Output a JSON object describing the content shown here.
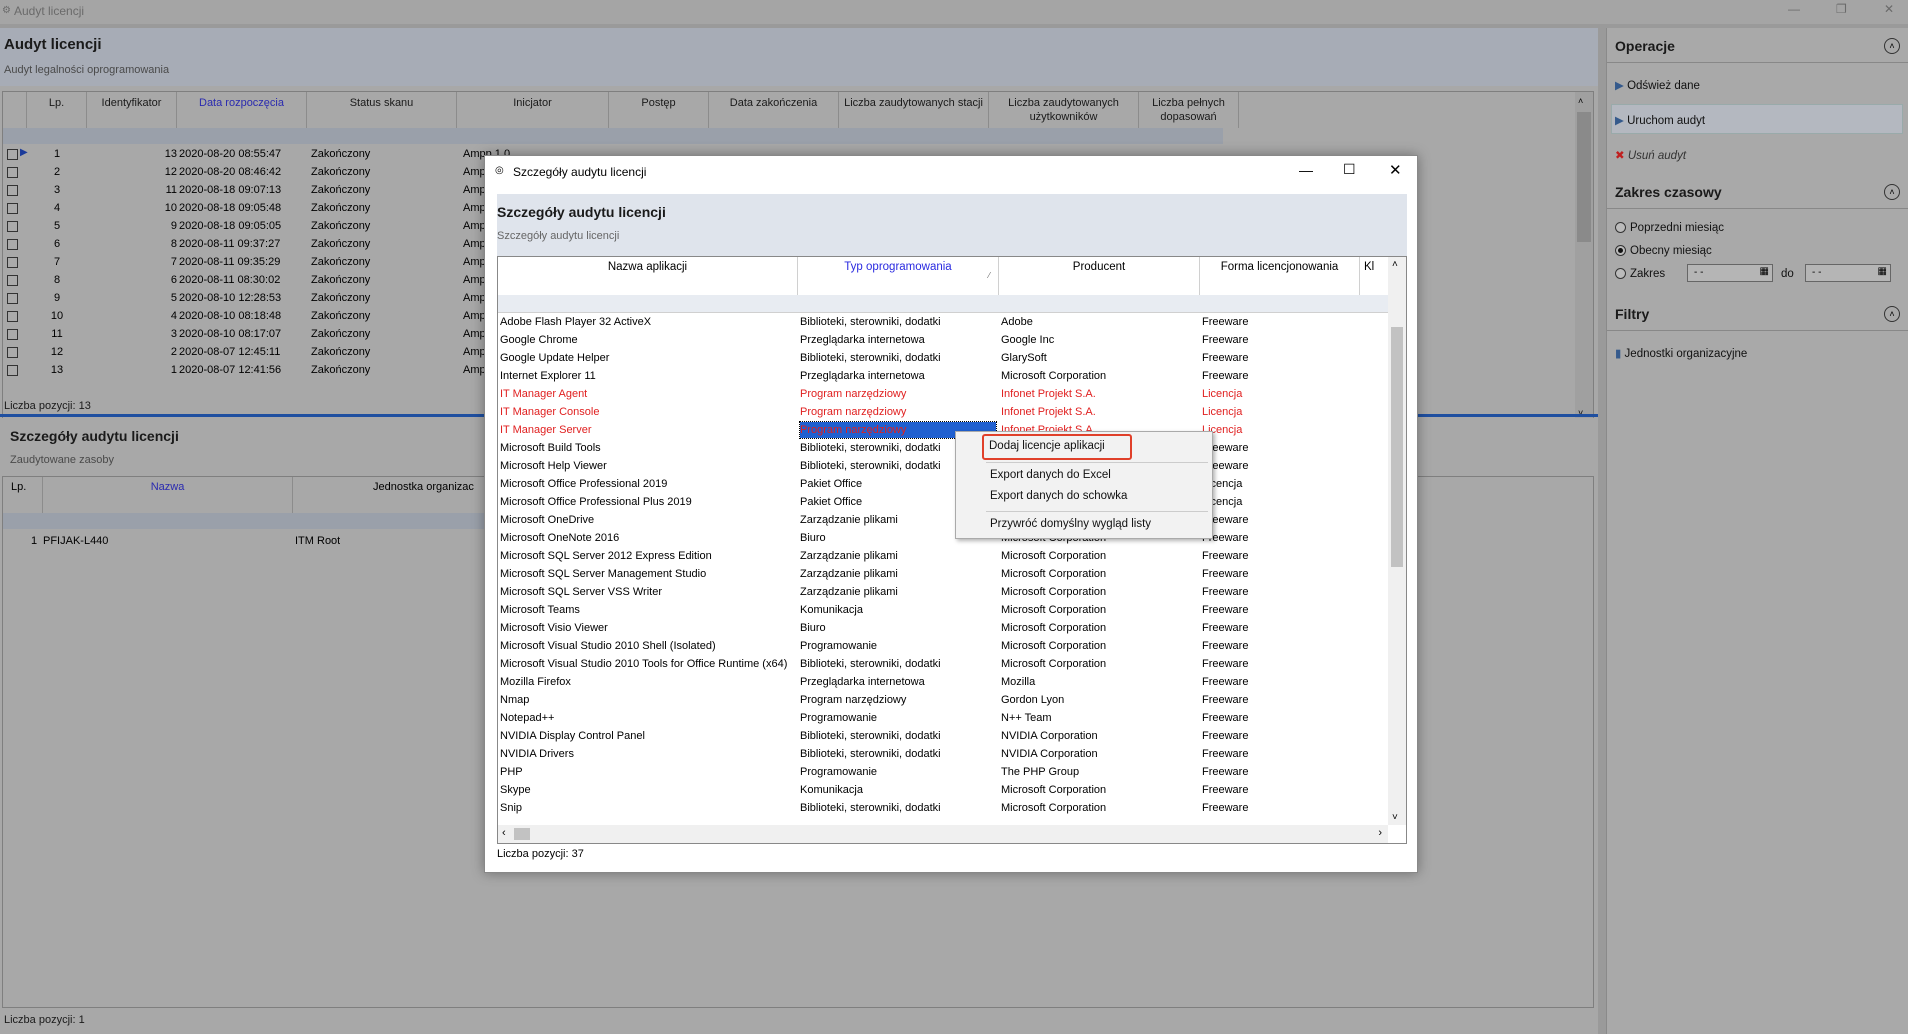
{
  "window": {
    "title": "Audyt licencji"
  },
  "top_panel": {
    "title": "Audyt licencji",
    "subtitle": "Audyt legalności oprogramowania",
    "columns": [
      "Lp.",
      "Identyfikator",
      "Data rozpoczęcia",
      "Status skanu",
      "Inicjator",
      "Postęp",
      "Data zakończenia",
      "Liczba zaudytowanych stacji",
      "Liczba zaudytowanych użytkowników",
      "Liczba pełnych dopasowań"
    ],
    "rows": [
      {
        "lp": "1",
        "id": "13",
        "date": "2020-08-20 08:55:47",
        "status": "Zakończony",
        "init": "Ampp 1.0..."
      },
      {
        "lp": "2",
        "id": "12",
        "date": "2020-08-20 08:46:42",
        "status": "Zakończony",
        "init": "Ampp 1.0"
      },
      {
        "lp": "3",
        "id": "11",
        "date": "2020-08-18 09:07:13",
        "status": "Zakończony",
        "init": "Ampp 1.0"
      },
      {
        "lp": "4",
        "id": "10",
        "date": "2020-08-18 09:05:48",
        "status": "Zakończony",
        "init": "Ampp 1.0"
      },
      {
        "lp": "5",
        "id": "9",
        "date": "2020-08-18 09:05:05",
        "status": "Zakończony",
        "init": "Ampp 1.0"
      },
      {
        "lp": "6",
        "id": "8",
        "date": "2020-08-11 09:37:27",
        "status": "Zakończony",
        "init": "Ampp 1.0"
      },
      {
        "lp": "7",
        "id": "7",
        "date": "2020-08-11 09:35:29",
        "status": "Zakończony",
        "init": "Ampp 1.0"
      },
      {
        "lp": "8",
        "id": "6",
        "date": "2020-08-11 08:30:02",
        "status": "Zakończony",
        "init": "Ampp 1.0"
      },
      {
        "lp": "9",
        "id": "5",
        "date": "2020-08-10 12:28:53",
        "status": "Zakończony",
        "init": "Ampp 1.0"
      },
      {
        "lp": "10",
        "id": "4",
        "date": "2020-08-10 08:18:48",
        "status": "Zakończony",
        "init": "Ampp 1.0"
      },
      {
        "lp": "11",
        "id": "3",
        "date": "2020-08-10 08:17:07",
        "status": "Zakończony",
        "init": "Ampp 1.0"
      },
      {
        "lp": "12",
        "id": "2",
        "date": "2020-08-07 12:45:11",
        "status": "Zakończony",
        "init": "Ampp 1.0"
      },
      {
        "lp": "13",
        "id": "1",
        "date": "2020-08-07 12:41:56",
        "status": "Zakończony",
        "init": "Ampp 1.0"
      }
    ],
    "count_label": "Liczba pozycji: 13"
  },
  "bottom_panel": {
    "title": "Szczegóły audytu licencji",
    "subtitle": "Zaudytowane zasoby",
    "columns": [
      "Lp.",
      "Nazwa",
      "Jednostka organizac"
    ],
    "rows": [
      {
        "lp": "1",
        "name": "PFIJAK-L440",
        "unit": "ITM Root"
      }
    ],
    "count_label": "Liczba pozycji: 1"
  },
  "right_panel": {
    "operacje": "Operacje",
    "refresh": "Odśwież dane",
    "run": "Uruchom audyt",
    "delete": "Usuń audyt",
    "zakres": "Zakres czasowy",
    "prev_month": "Poprzedni miesiąc",
    "this_month": "Obecny miesiąc",
    "range": "Zakres",
    "date_placeholder": "- -",
    "to": "do",
    "filtry": "Filtry",
    "org_units": "Jednostki organizacyjne"
  },
  "dialog": {
    "title": "Szczegóły audytu licencji",
    "header": "Szczegóły audytu licencji",
    "subheader": "Szczegóły audytu licencji",
    "columns": [
      "Nazwa aplikacji",
      "Typ oprogramowania",
      "Producent",
      "Forma licencjonowania",
      "Kl"
    ],
    "rows": [
      {
        "name": "Adobe Flash Player 32 ActiveX",
        "type": "Biblioteki, sterowniki, dodatki",
        "vendor": "Adobe",
        "lic": "Freeware",
        "red": false
      },
      {
        "name": "Google Chrome",
        "type": "Przeglądarka internetowa",
        "vendor": "Google Inc",
        "lic": "Freeware",
        "red": false
      },
      {
        "name": "Google Update Helper",
        "type": "Biblioteki, sterowniki, dodatki",
        "vendor": "GlarySoft",
        "lic": "Freeware",
        "red": false
      },
      {
        "name": "Internet Explorer 11",
        "type": "Przeglądarka internetowa",
        "vendor": "Microsoft Corporation",
        "lic": "Freeware",
        "red": false
      },
      {
        "name": "IT Manager Agent",
        "type": "Program narzędziowy",
        "vendor": "Infonet Projekt S.A.",
        "lic": "Licencja",
        "red": true
      },
      {
        "name": "IT Manager Console",
        "type": "Program narzędziowy",
        "vendor": "Infonet Projekt S.A.",
        "lic": "Licencja",
        "red": true
      },
      {
        "name": "IT Manager Server",
        "type": "Program narzędziowy",
        "vendor": "Infonet Projekt S.A.",
        "lic": "Licencja",
        "red": true
      },
      {
        "name": "Microsoft Build Tools",
        "type": "Biblioteki, sterowniki, dodatki",
        "vendor": "",
        "lic": "Freeware",
        "red": false
      },
      {
        "name": "Microsoft Help Viewer",
        "type": "Biblioteki, sterowniki, dodatki",
        "vendor": "",
        "lic": "Freeware",
        "red": false
      },
      {
        "name": "Microsoft Office Professional 2019",
        "type": "Pakiet Office",
        "vendor": "",
        "lic": "Licencja",
        "red": false
      },
      {
        "name": "Microsoft Office Professional Plus 2019",
        "type": "Pakiet Office",
        "vendor": "",
        "lic": "Licencja",
        "red": false
      },
      {
        "name": "Microsoft OneDrive",
        "type": "Zarządzanie plikami",
        "vendor": "",
        "lic": "Freeware",
        "red": false
      },
      {
        "name": "Microsoft OneNote 2016",
        "type": "Biuro",
        "vendor": "Microsoft Corporation",
        "lic": "Freeware",
        "red": false
      },
      {
        "name": "Microsoft SQL Server 2012 Express Edition",
        "type": "Zarządzanie plikami",
        "vendor": "Microsoft Corporation",
        "lic": "Freeware",
        "red": false
      },
      {
        "name": "Microsoft SQL Server Management Studio",
        "type": "Zarządzanie plikami",
        "vendor": "Microsoft Corporation",
        "lic": "Freeware",
        "red": false
      },
      {
        "name": "Microsoft SQL Server VSS Writer",
        "type": "Zarządzanie plikami",
        "vendor": "Microsoft Corporation",
        "lic": "Freeware",
        "red": false
      },
      {
        "name": "Microsoft Teams",
        "type": "Komunikacja",
        "vendor": "Microsoft Corporation",
        "lic": "Freeware",
        "red": false
      },
      {
        "name": "Microsoft Visio Viewer",
        "type": "Biuro",
        "vendor": "Microsoft Corporation",
        "lic": "Freeware",
        "red": false
      },
      {
        "name": "Microsoft Visual Studio 2010 Shell (Isolated)",
        "type": "Programowanie",
        "vendor": "Microsoft Corporation",
        "lic": "Freeware",
        "red": false
      },
      {
        "name": "Microsoft Visual Studio 2010 Tools for Office Runtime (x64)",
        "type": "Biblioteki, sterowniki, dodatki",
        "vendor": "Microsoft Corporation",
        "lic": "Freeware",
        "red": false
      },
      {
        "name": "Mozilla Firefox",
        "type": "Przeglądarka internetowa",
        "vendor": "Mozilla",
        "lic": "Freeware",
        "red": false
      },
      {
        "name": "Nmap",
        "type": "Program narzędziowy",
        "vendor": "Gordon Lyon",
        "lic": "Freeware",
        "red": false
      },
      {
        "name": "Notepad++",
        "type": "Programowanie",
        "vendor": "N++ Team",
        "lic": "Freeware",
        "red": false
      },
      {
        "name": "NVIDIA Display Control Panel",
        "type": "Biblioteki, sterowniki, dodatki",
        "vendor": "NVIDIA Corporation",
        "lic": "Freeware",
        "red": false
      },
      {
        "name": "NVIDIA Drivers",
        "type": "Biblioteki, sterowniki, dodatki",
        "vendor": "NVIDIA Corporation",
        "lic": "Freeware",
        "red": false
      },
      {
        "name": "PHP",
        "type": "Programowanie",
        "vendor": "The PHP Group",
        "lic": "Freeware",
        "red": false
      },
      {
        "name": "Skype",
        "type": "Komunikacja",
        "vendor": "Microsoft Corporation",
        "lic": "Freeware",
        "red": false
      },
      {
        "name": "Snip",
        "type": "Biblioteki, sterowniki, dodatki",
        "vendor": "Microsoft Corporation",
        "lic": "Freeware",
        "red": false
      }
    ],
    "count_label": "Liczba pozycji: 37"
  },
  "context_menu": {
    "items": [
      "Dodaj licencje aplikacji",
      "Export danych do Excel",
      "Export danych do schowka",
      "Przywróć domyślny wygląd listy"
    ]
  }
}
